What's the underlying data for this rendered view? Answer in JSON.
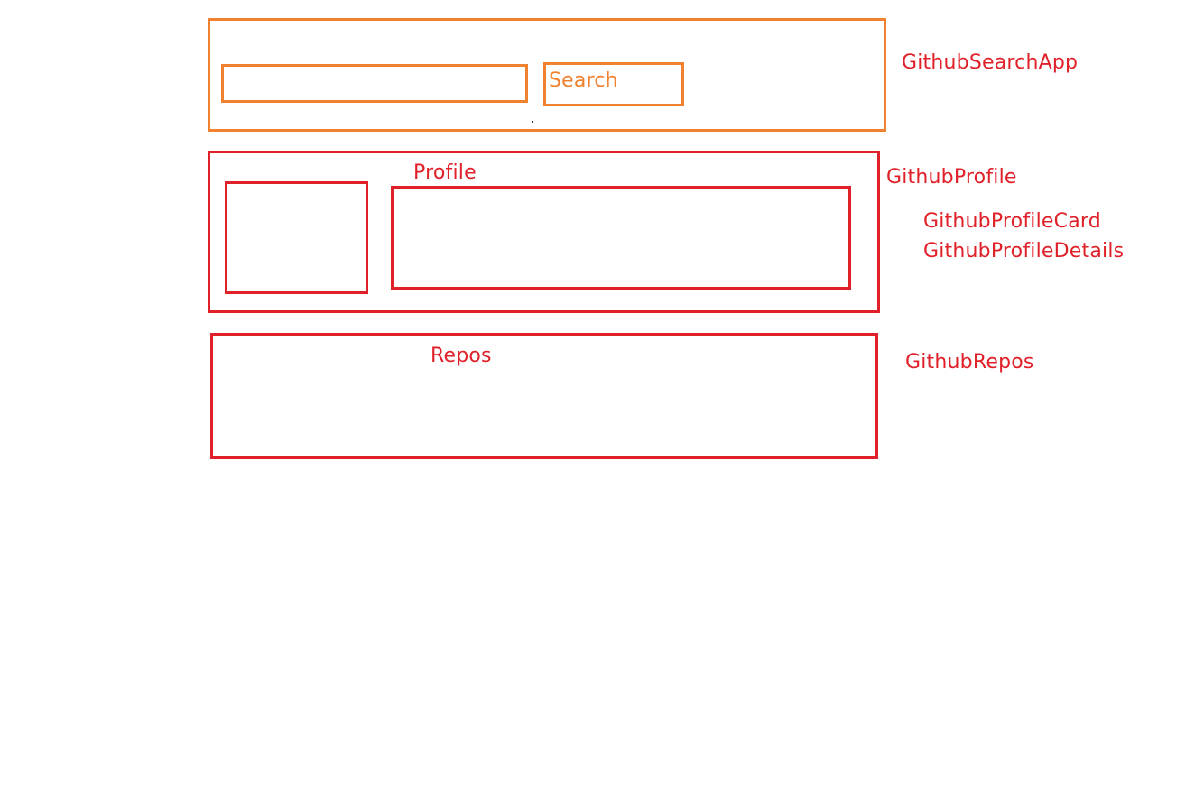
{
  "colors": {
    "search_section": "#f0822f",
    "profile_section": "#e02129",
    "repos_section": "#e02129"
  },
  "search_app": {
    "component_name": "GithubSearchApp",
    "input_value": "",
    "button_label": "Search"
  },
  "profile": {
    "heading": "Profile",
    "component_name": "GithubProfile",
    "card_component_name": "GithubProfileCard",
    "details_component_name": "GithubProfileDetails"
  },
  "repos": {
    "heading": "Repos",
    "component_name": "GithubRepos"
  }
}
